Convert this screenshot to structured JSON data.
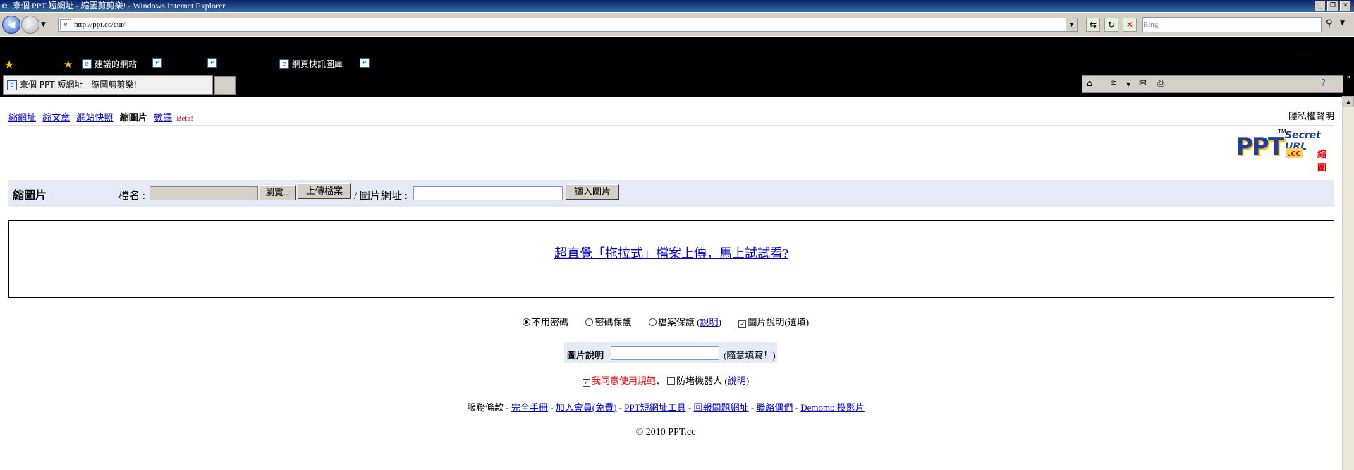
{
  "window": {
    "title": "來個 PPT 短網址 - 縮圖剪剪樂! - Windows Internet Explorer"
  },
  "address": {
    "url": "http://ppt.cc/cut/"
  },
  "search": {
    "placeholder": "Bing"
  },
  "favorites": {
    "items": [
      {
        "label": "建議的網站"
      },
      {
        "label": "網頁快訊圖庫"
      }
    ]
  },
  "tab": {
    "label": "來個 PPT 短網址 - 縮圖剪剪樂!"
  },
  "nav": {
    "links": [
      "縮網址",
      "縮文章",
      "網站快照"
    ],
    "current": "縮圖片",
    "data_link": "數譯",
    "beta": "Beta!",
    "privacy": "隱私權聲明"
  },
  "logo": {
    "brand": "PPT",
    "tagline": "Secret URL",
    "tld": ".cc",
    "sub": "縮圖",
    "tm": "TM"
  },
  "upload": {
    "heading": "縮圖片",
    "filename_label": "檔名 :",
    "browse_button": "瀏覽...",
    "upload_button": "上傳檔案",
    "url_label": "/ 圖片網址 :",
    "load_button": "讀入圖片"
  },
  "dragdrop": {
    "link": "超直覺「拖拉式」檔案上傳，馬上試試看?"
  },
  "options": {
    "no_password": "不用密碼",
    "password_protect": "密碼保護",
    "file_protect": "檔案保護 (",
    "explain": "說明",
    "close_paren": ")",
    "caption_opt": "圖片說明(選填)"
  },
  "caption": {
    "label": "圖片說明",
    "hint": "(隨意填寫！)"
  },
  "agree": {
    "terms": "我同意使用規範",
    "sep": "、",
    "antibot": "防堵機器人 (",
    "explain": "說明",
    "close_paren": ")"
  },
  "footer": {
    "prefix": "服務條款 -",
    "links": [
      "完全手冊",
      "加入會員(免費)",
      "PPT短網址工具",
      "回報問題網址",
      "聯絡偶們",
      "Demomo 投影片"
    ],
    "sep": " - ",
    "copyright": "© 2010 PPT.cc"
  }
}
